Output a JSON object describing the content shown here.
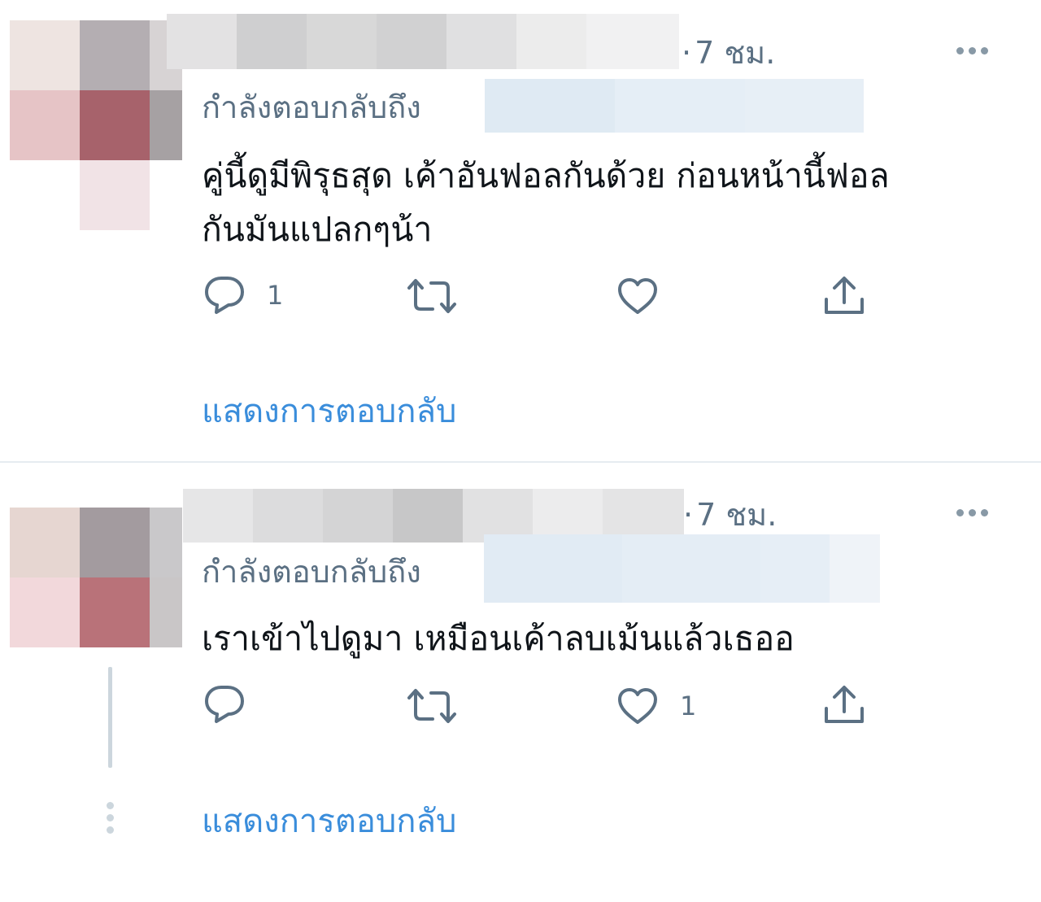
{
  "tweets": [
    {
      "time": "7 ชม.",
      "time_separator": "·",
      "replying_label": "กำลังตอบกลับถึง",
      "text_lines": [
        "คู่นี้ดูมีพิรุธสุด เค้าอันฟอลกันด้วย ก่อนหน้านี้ฟอล",
        "กันมันแปลกๆน้า"
      ],
      "reply_count": "1",
      "retweet_count": "",
      "like_count": "",
      "show_replies": "แสดงการตอบกลับ"
    },
    {
      "time": "7 ชม.",
      "time_separator": "·",
      "replying_label": "กำลังตอบกลับถึง",
      "text_lines": [
        "เราเข้าไปดูมา เหมือนเค้าลบเม้นแล้วเธออ"
      ],
      "reply_count": "",
      "retweet_count": "",
      "like_count": "1",
      "show_replies": "แสดงการตอบกลับ"
    }
  ],
  "icons": {
    "reply": "reply-icon",
    "retweet": "retweet-icon",
    "like": "like-icon",
    "share": "share-icon",
    "more": "more-icon"
  },
  "colors": {
    "link": "#3a8ddb",
    "muted": "#5b7083",
    "text": "#0f1419",
    "divider": "#e6ecf0"
  }
}
